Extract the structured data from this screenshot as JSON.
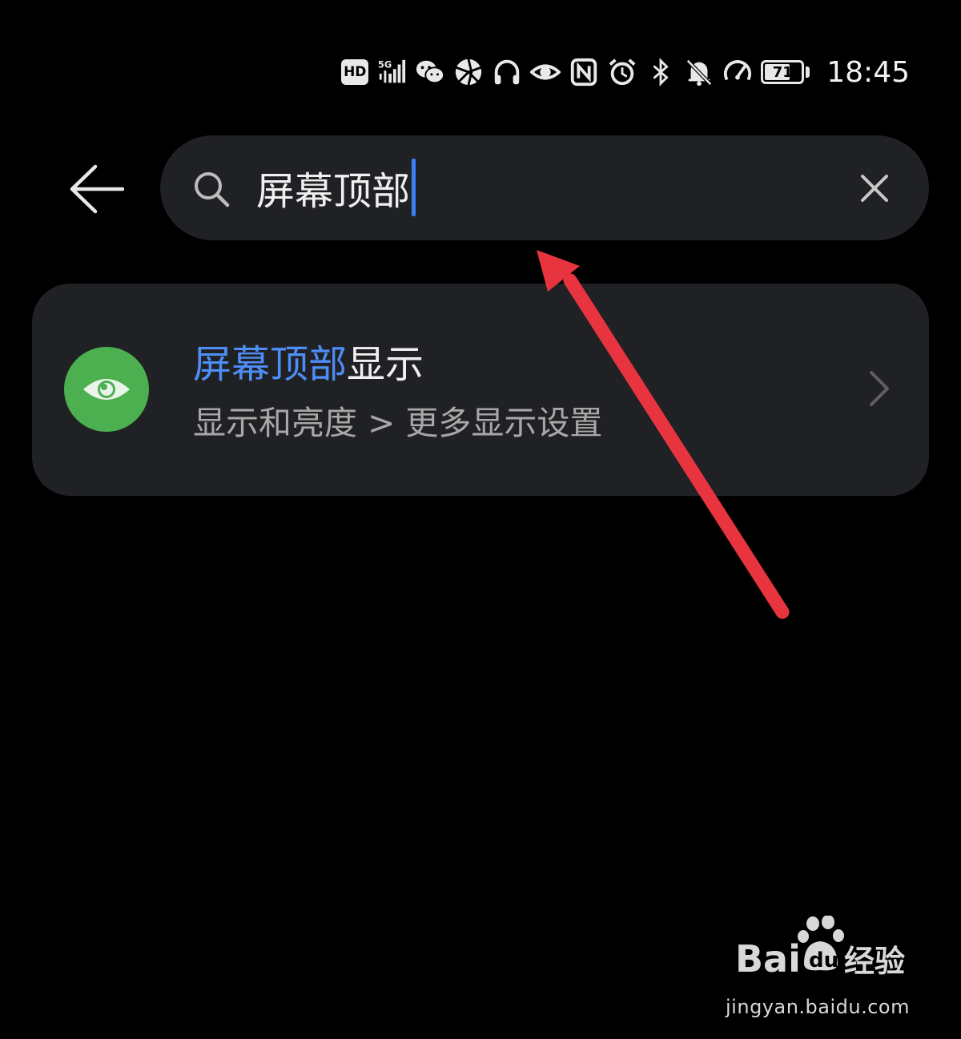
{
  "status_bar": {
    "network_badge": "HD",
    "signal_label": "5G",
    "battery_level": "71",
    "battery_fraction": 0.71,
    "time": "18:45",
    "icons": [
      "hd-badge",
      "5g-signal-icon",
      "wechat-icon",
      "app-icon",
      "headphones-icon",
      "eye-comfort-icon",
      "nfc-icon",
      "alarm-icon",
      "bluetooth-icon",
      "mute-icon",
      "data-speed-icon",
      "battery-icon"
    ]
  },
  "header": {
    "back_icon": "arrow-left-icon",
    "search": {
      "query": "屏幕顶部",
      "search_icon": "search-icon",
      "clear_icon": "close-icon"
    }
  },
  "results": [
    {
      "icon": "eye-icon",
      "icon_color": "#4caf50",
      "title_highlight": "屏幕顶部",
      "title_rest": "显示",
      "highlight_color": "#4e8ef7",
      "path": "显示和亮度 > 更多显示设置"
    }
  ],
  "annotation": {
    "color": "#e8343f"
  },
  "watermark": {
    "logo_text": "Bai du 经验",
    "url": "jingyan.baidu.com"
  }
}
